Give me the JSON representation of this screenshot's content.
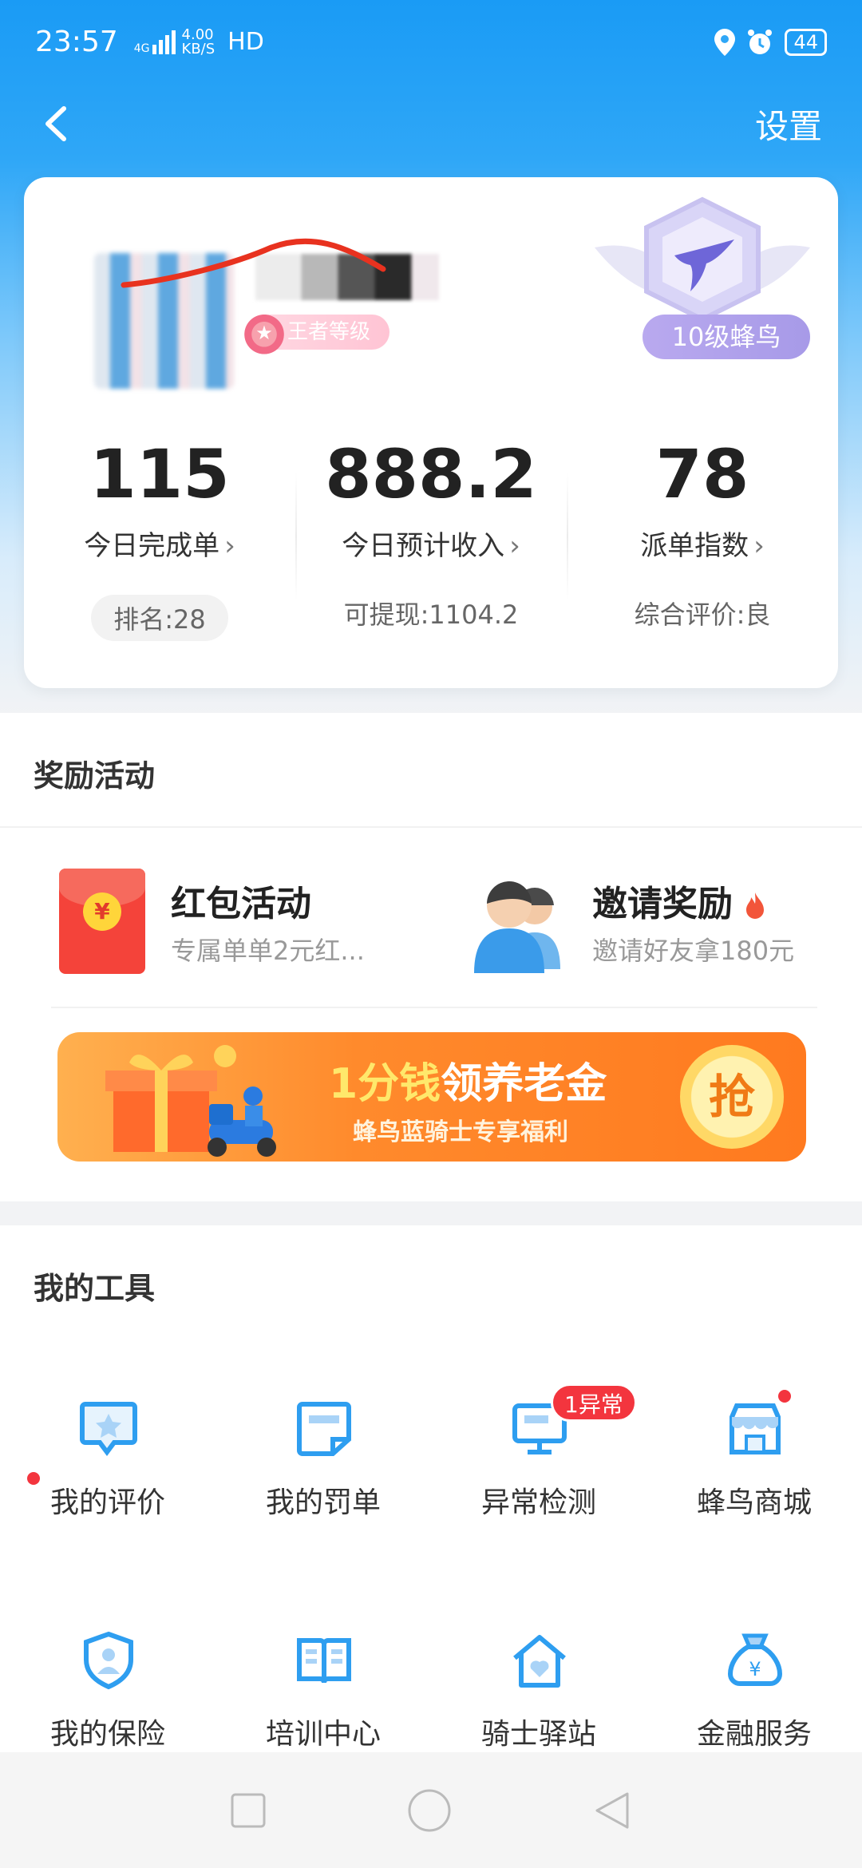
{
  "status_bar": {
    "time": "23:57",
    "network": "4G",
    "speed_value": "4.00",
    "speed_unit": "KB/S",
    "hd": "HD",
    "battery": "44"
  },
  "header": {
    "settings_label": "设置"
  },
  "profile": {
    "level_badge": "王者等级",
    "rank_label": "10级蜂鸟",
    "stats": [
      {
        "value": "115",
        "label": "今日完成单",
        "sub": "排名:28"
      },
      {
        "value": "888.2",
        "label": "今日预计收入",
        "sub": "可提现:1104.2"
      },
      {
        "value": "78",
        "label": "派单指数",
        "sub": "综合评价:良"
      }
    ]
  },
  "rewards": {
    "title": "奖励活动",
    "items": [
      {
        "title": "红包活动",
        "desc": "专属单单2元红..."
      },
      {
        "title": "邀请奖励",
        "desc": "邀请好友拿180元"
      }
    ],
    "banner": {
      "headline_highlight": "1分钱",
      "headline_rest": "领养老金",
      "subline": "蜂鸟蓝骑士专享福利",
      "grab": "抢"
    }
  },
  "tools": {
    "title": "我的工具",
    "items": [
      {
        "label": "我的评价",
        "icon": "comment-star-icon"
      },
      {
        "label": "我的罚单",
        "icon": "ticket-icon"
      },
      {
        "label": "异常检测",
        "icon": "monitor-icon",
        "badge": "1异常"
      },
      {
        "label": "蜂鸟商城",
        "icon": "store-icon"
      },
      {
        "label": "我的保险",
        "icon": "shield-user-icon"
      },
      {
        "label": "培训中心",
        "icon": "book-icon"
      },
      {
        "label": "骑士驿站",
        "icon": "home-heart-icon"
      },
      {
        "label": "金融服务",
        "icon": "money-bag-icon"
      }
    ]
  },
  "colors": {
    "brand_blue": "#1a9bf5",
    "icon_blue": "#2e9ef0",
    "badge_red": "#f3353e"
  }
}
